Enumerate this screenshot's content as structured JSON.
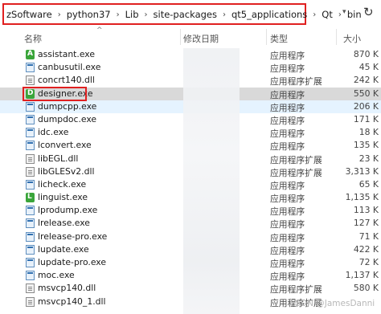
{
  "breadcrumb": [
    "zSoftware",
    "python37",
    "Lib",
    "site-packages",
    "qt5_applications",
    "Qt",
    "bin"
  ],
  "header": {
    "name": "名称",
    "modified": "修改日期",
    "type": "类型",
    "size": "大小"
  },
  "files": [
    {
      "name": "assistant.exe",
      "type": "应用程序",
      "size": "870 K",
      "icon": "assistant-icon",
      "letter": "A"
    },
    {
      "name": "canbusutil.exe",
      "type": "应用程序",
      "size": "45 K",
      "icon": "exe-icon"
    },
    {
      "name": "concrt140.dll",
      "type": "应用程序扩展",
      "size": "242 K",
      "icon": "dll-icon"
    },
    {
      "name": "designer.exe",
      "type": "应用程序",
      "size": "550 K",
      "icon": "designer-icon",
      "letter": "D"
    },
    {
      "name": "dumpcpp.exe",
      "type": "应用程序",
      "size": "206 K",
      "icon": "exe-icon"
    },
    {
      "name": "dumpdoc.exe",
      "type": "应用程序",
      "size": "171 K",
      "icon": "exe-icon"
    },
    {
      "name": "idc.exe",
      "type": "应用程序",
      "size": "18 K",
      "icon": "exe-icon"
    },
    {
      "name": "lconvert.exe",
      "type": "应用程序",
      "size": "135 K",
      "icon": "exe-icon"
    },
    {
      "name": "libEGL.dll",
      "type": "应用程序扩展",
      "size": "23 K",
      "icon": "dll-icon"
    },
    {
      "name": "libGLESv2.dll",
      "type": "应用程序扩展",
      "size": "3,313 K",
      "icon": "dll-icon"
    },
    {
      "name": "licheck.exe",
      "type": "应用程序",
      "size": "65 K",
      "icon": "exe-icon"
    },
    {
      "name": "linguist.exe",
      "type": "应用程序",
      "size": "1,135 K",
      "icon": "linguist-icon",
      "letter": "L"
    },
    {
      "name": "lprodump.exe",
      "type": "应用程序",
      "size": "113 K",
      "icon": "exe-icon"
    },
    {
      "name": "lrelease.exe",
      "type": "应用程序",
      "size": "127 K",
      "icon": "exe-icon"
    },
    {
      "name": "lrelease-pro.exe",
      "type": "应用程序",
      "size": "71 K",
      "icon": "exe-icon"
    },
    {
      "name": "lupdate.exe",
      "type": "应用程序",
      "size": "422 K",
      "icon": "exe-icon"
    },
    {
      "name": "lupdate-pro.exe",
      "type": "应用程序",
      "size": "72 K",
      "icon": "exe-icon"
    },
    {
      "name": "moc.exe",
      "type": "应用程序",
      "size": "1,137 K",
      "icon": "exe-icon"
    },
    {
      "name": "msvcp140.dll",
      "type": "应用程序扩展",
      "size": "580 K",
      "icon": "dll-icon"
    },
    {
      "name": "msvcp140_1.dll",
      "type": "应用程序扩展",
      "size": "",
      "icon": "dll-icon"
    }
  ],
  "watermark": "CSDN @JamesDanni",
  "colors": {
    "highlight_red": "#e02020",
    "selected_row": "#cce8ff",
    "hover_row": "#e5f3ff"
  }
}
